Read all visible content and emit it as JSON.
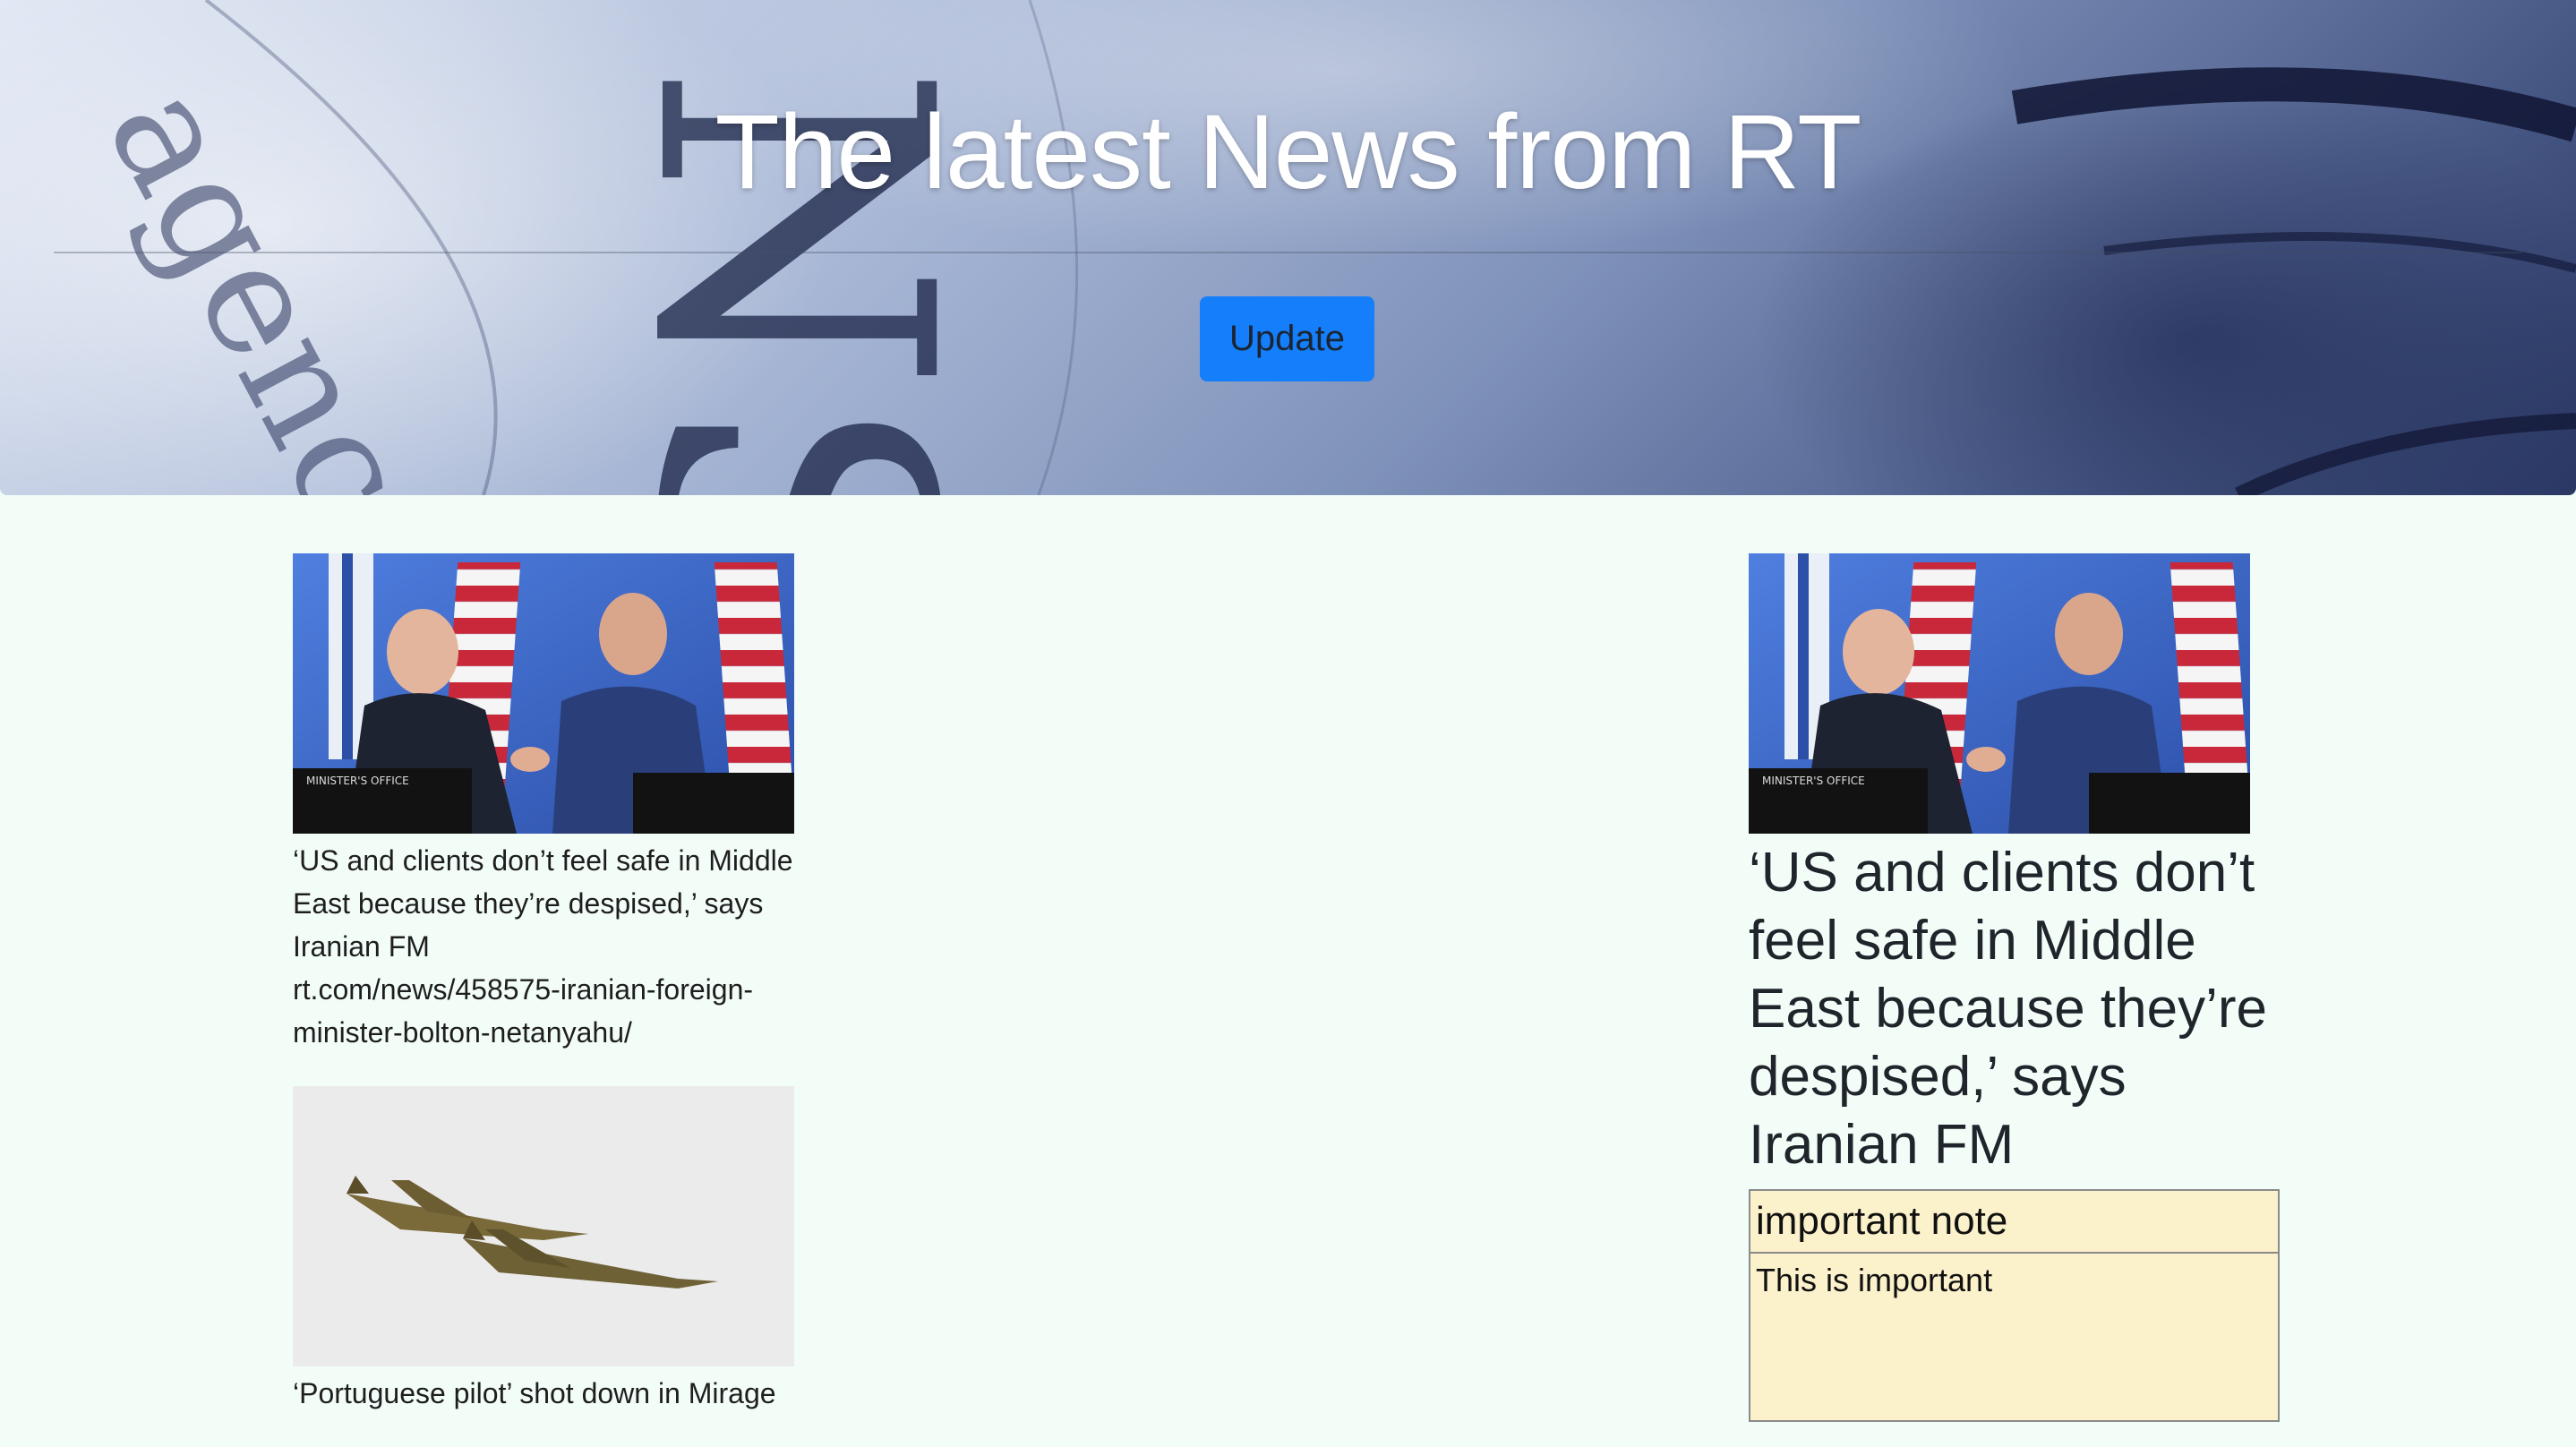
{
  "header": {
    "title": "The latest News from RT",
    "update_label": "Update"
  },
  "news": [
    {
      "title": "‘US and clients don’t feel safe in Middle East because they’re despised,’ says Iranian FM",
      "url": "rt.com/news/458575-iranian-foreign-minister-bolton-netanyahu/",
      "image": "handshake-photo"
    },
    {
      "title": "‘Portuguese pilot’ shot down in Mirage",
      "image": "jet-photo"
    }
  ],
  "detail": {
    "headline": "‘US and clients don’t feel safe in Middle East because they’re despised,’ says Iranian FM",
    "image": "handshake-photo"
  },
  "note": {
    "title": "important note",
    "body": "This is important"
  },
  "colors": {
    "page_background": "#f3fdf8",
    "button": "#147efb",
    "note_background": "#fbf1cb"
  }
}
